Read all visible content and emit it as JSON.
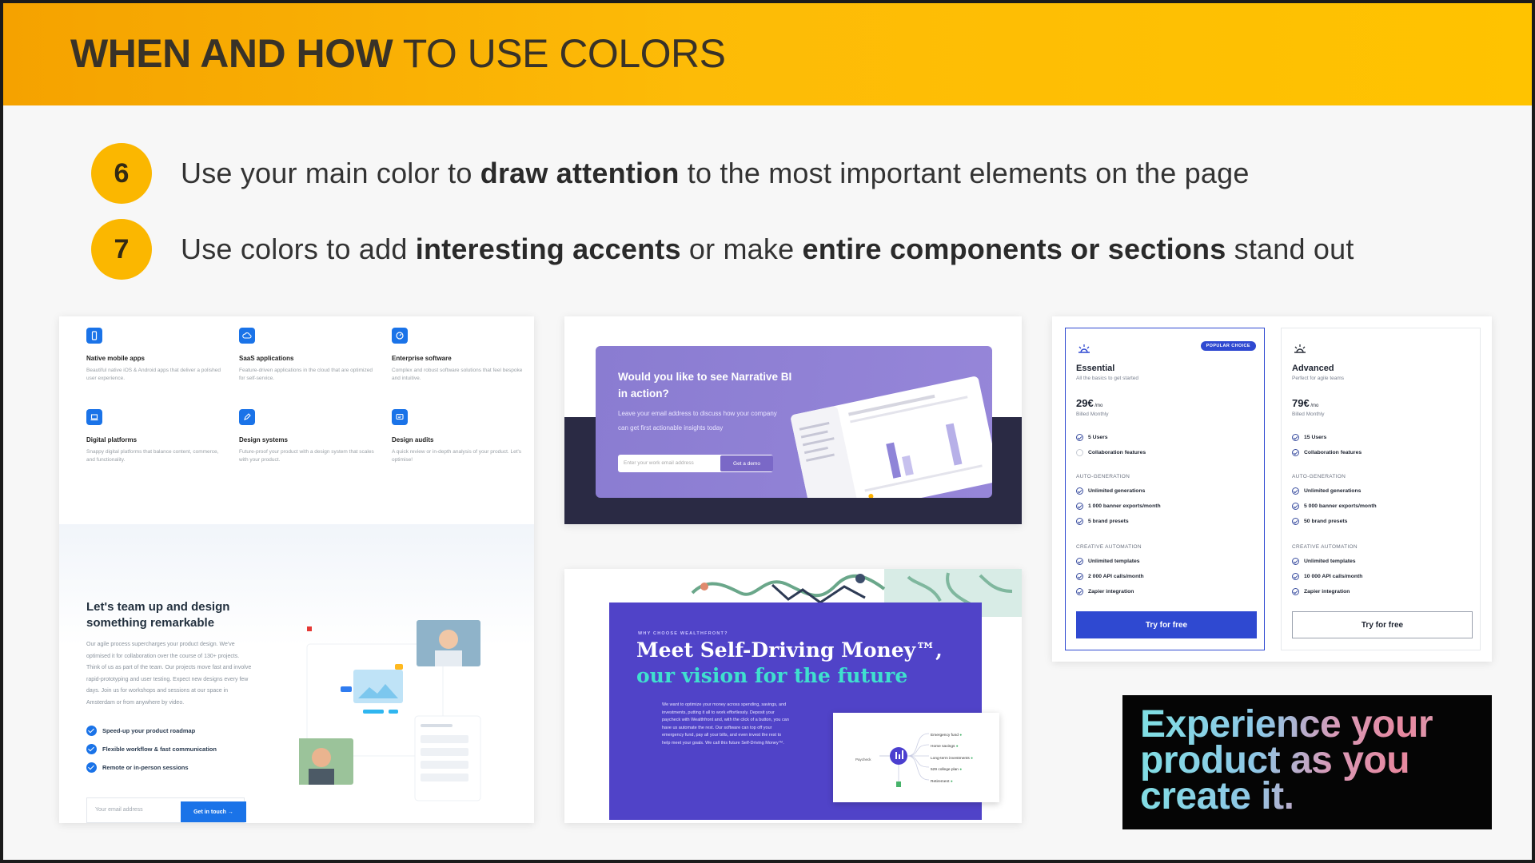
{
  "header": {
    "title_bold": "WHEN AND HOW",
    "title_rest": " TO USE COLORS"
  },
  "points": [
    {
      "num": "6",
      "t1": "Use your main color to ",
      "b1": "draw attention",
      "t2": " to the most important elements on the page",
      "b2": "",
      "t3": ""
    },
    {
      "num": "7",
      "t1": "Use colors to add ",
      "b1": "interesting accents",
      "t2": " or make ",
      "b2": "entire components or sections",
      "t3": " stand out"
    }
  ],
  "card1": {
    "services": [
      {
        "title": "Native mobile apps",
        "desc": "Beautiful native iOS & Android apps that deliver a polished user experience.",
        "icon": "phone-icon"
      },
      {
        "title": "SaaS applications",
        "desc": "Feature-driven applications in the cloud that are optimized for self-service.",
        "icon": "cloud-icon"
      },
      {
        "title": "Enterprise software",
        "desc": "Complex and robust software solutions that feel bespoke and intuitive.",
        "icon": "dashboard-icon"
      },
      {
        "title": "Digital platforms",
        "desc": "Snappy digital platforms that balance content, commerce, and functionality.",
        "icon": "laptop-icon"
      },
      {
        "title": "Design systems",
        "desc": "Future-proof your product with a design system that scales with your product.",
        "icon": "pencil-icon"
      },
      {
        "title": "Design audits",
        "desc": "A quick review or in-depth analysis of your product. Let's optimise!",
        "icon": "chat-icon"
      }
    ],
    "title": "Let's team up and design something remarkable",
    "body": "Our agile process supercharges your product design. We've optimised it for collaboration over the course of 130+ projects. Think of us as part of the team. Our projects move fast and involve rapid-prototyping and user testing. Expect new designs every few days. Join us for workshops and sessions at our space in Amsterdam or from anywhere by video.",
    "checks": [
      "Speed-up your product roadmap",
      "Flexible workflow & fast communication",
      "Remote or in-person sessions"
    ],
    "email_placeholder": "Your email address",
    "cta": "Get in touch  →"
  },
  "card2": {
    "title": "Would you like to see Narrative BI in action?",
    "sub": "Leave your email address to discuss how your company can get first actionable insights today",
    "email_placeholder": "Enter your work email address",
    "cta": "Get a demo"
  },
  "card3": {
    "eyebrow": "WHY CHOOSE WEALTHFRONT?",
    "h1": "Meet Self-Driving Money™,",
    "h2": "our vision for the future",
    "body": "We want to optimize your money across spending, savings, and investments, putting it all to work effortlessly. Deposit your paycheck with Wealthfront and, with the click of a button, you can have us automate the rest. Our software can top off your emergency fund, pay all your bills, and even invest the rest to help meet your goals. We call this future Self-Driving Money™.",
    "flow_items": [
      "Emergency fund",
      "Home savings",
      "Long-term investments",
      "529 college plan",
      "Retirement"
    ],
    "flow_left": "Paycheck"
  },
  "card4": {
    "plans": [
      {
        "name": "Essential",
        "sub": "All the basics to get started",
        "price": "29€",
        "per": " /mo",
        "billing": "Billed Monthly",
        "badge": "POPULAR CHOICE",
        "f1": "5 Users",
        "f2": "Collaboration features",
        "sec1": "AUTO-GENERATION",
        "g1": "Unlimited generations",
        "g2": "1 000 banner exports/month",
        "g3": "5 brand presets",
        "sec2": "CREATIVE AUTOMATION",
        "c1": "Unlimited templates",
        "c2": "2 000 API calls/month",
        "c3": "Zapier integration",
        "cta": "Try for free"
      },
      {
        "name": "Advanced",
        "sub": "Perfect for agile teams",
        "price": "79€",
        "per": " /mo",
        "billing": "Billed Monthly",
        "badge": "",
        "f1": "15 Users",
        "f2": "Collaboration features",
        "sec1": "AUTO-GENERATION",
        "g1": "Unlimited generations",
        "g2": "5 000 banner exports/month",
        "g3": "50 brand presets",
        "sec2": "CREATIVE AUTOMATION",
        "c1": "Unlimited templates",
        "c2": "10 000 API calls/month",
        "c3": "Zapier integration",
        "cta": "Try for free"
      }
    ]
  },
  "card5": {
    "text": "Experience your product as you create it."
  },
  "colors": {
    "accent": "#fbb700",
    "blue": "#1a73e8",
    "purple": "#8a7cd1",
    "indigo": "#5043c8",
    "teal": "#3fe0cf",
    "plan_blue": "#2f49d1"
  }
}
